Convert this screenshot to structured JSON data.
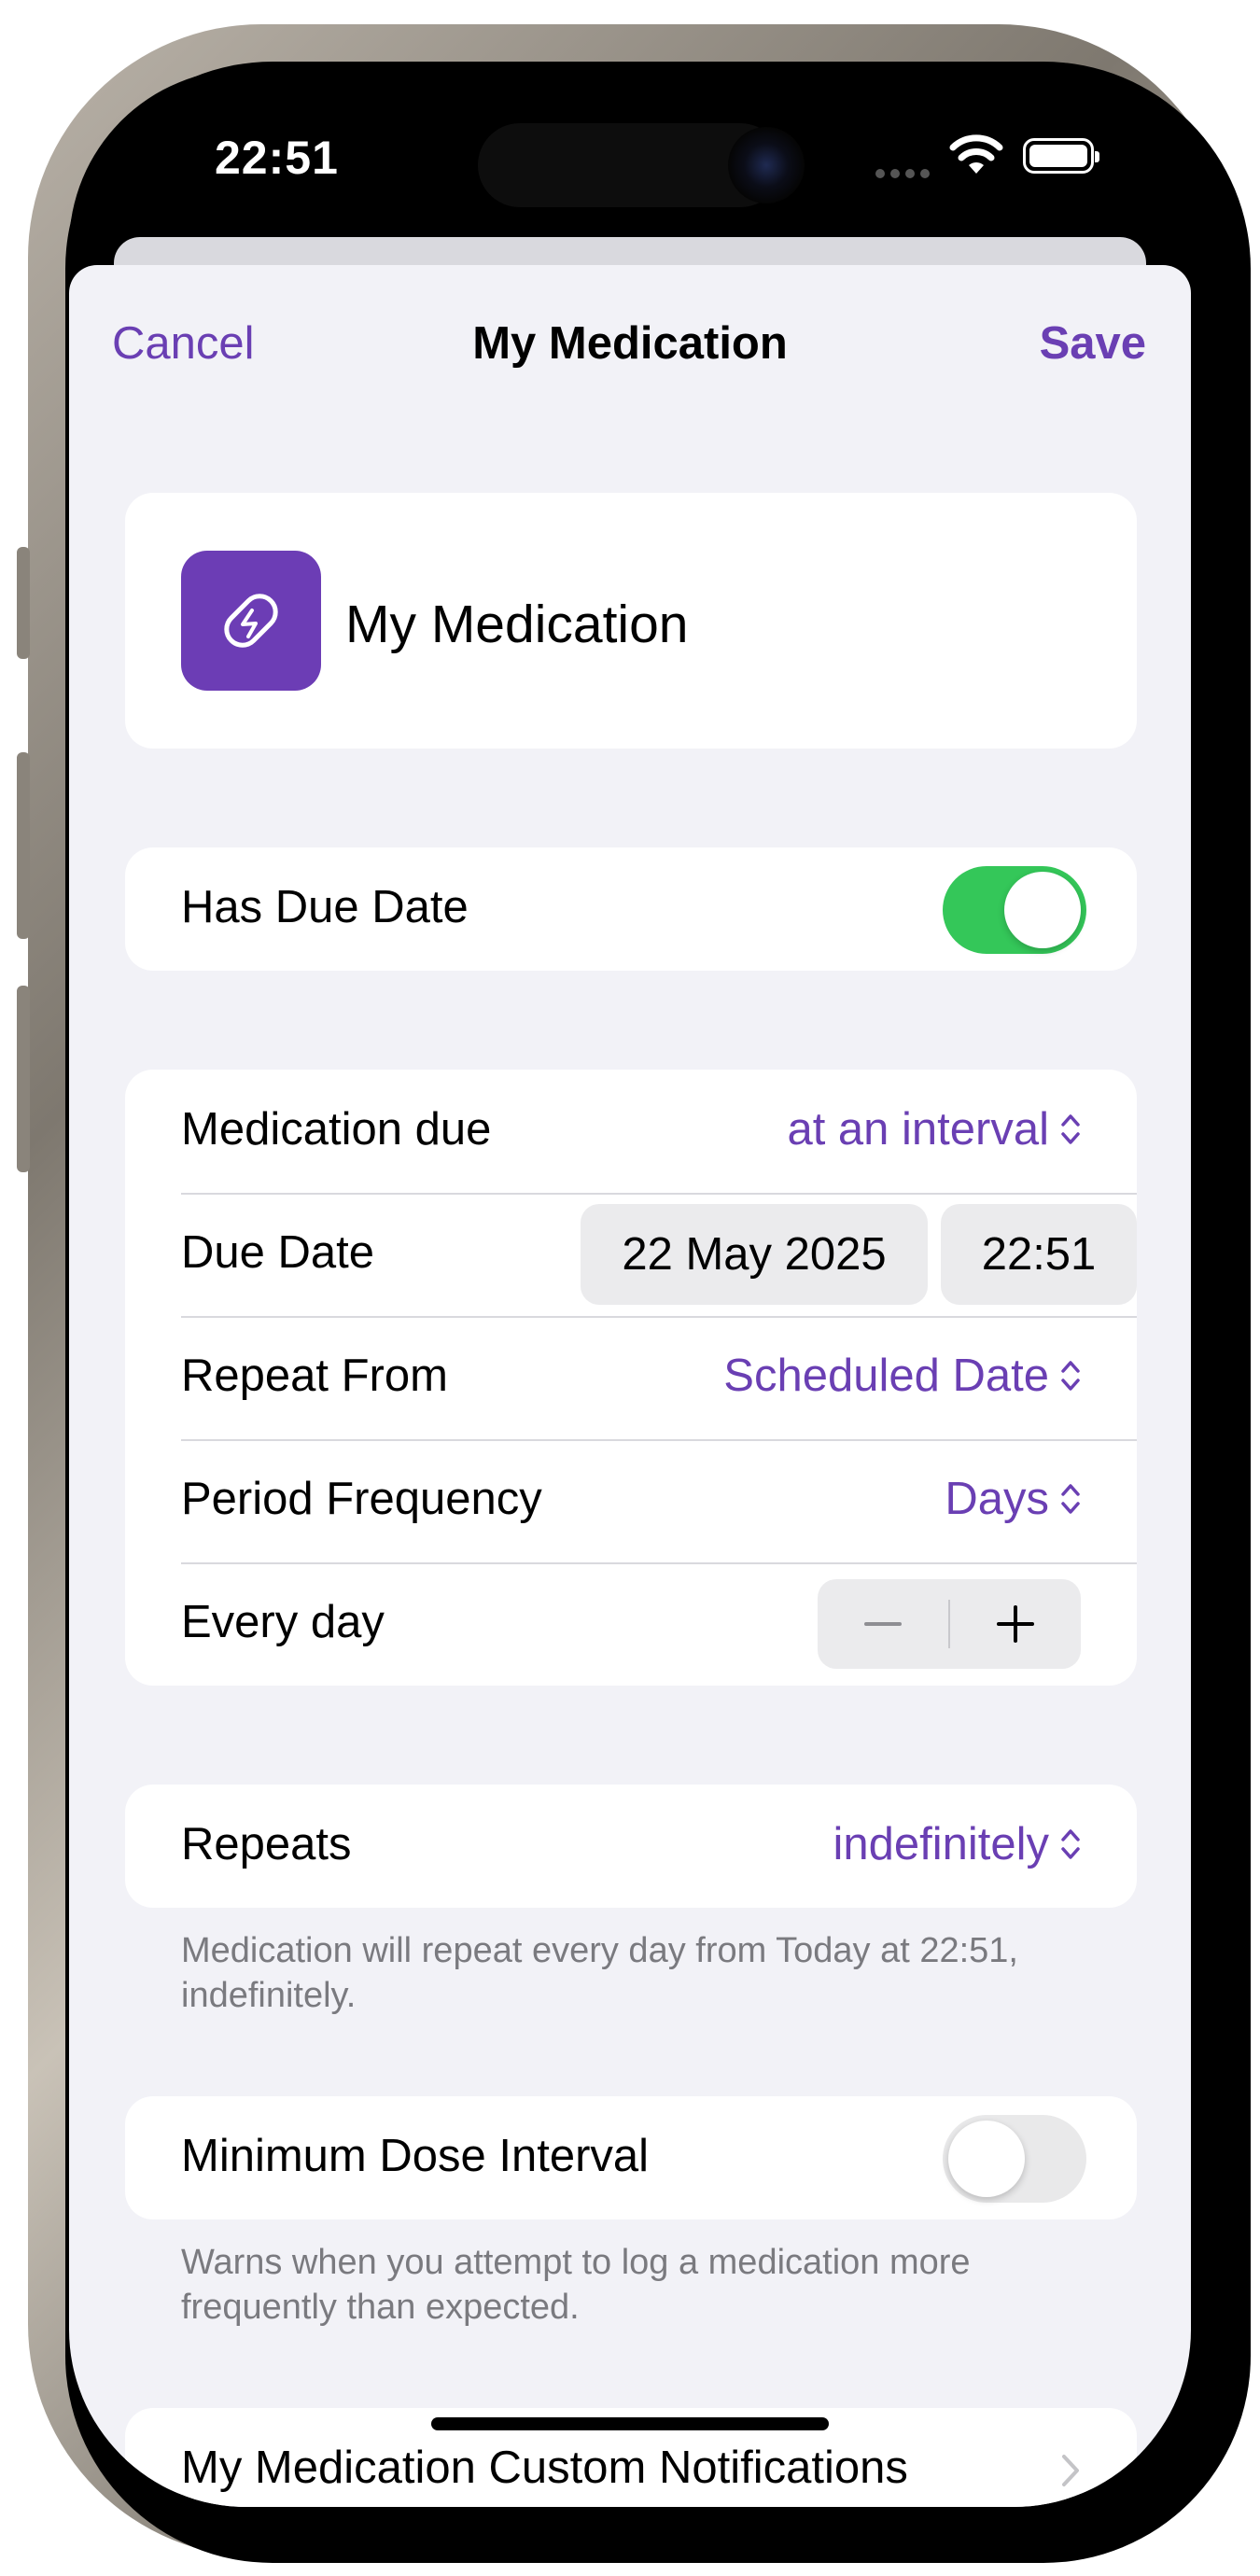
{
  "status_bar": {
    "time": "22:51"
  },
  "nav": {
    "cancel": "Cancel",
    "title": "My Medication",
    "save": "Save"
  },
  "medication": {
    "name": "My Medication",
    "icon": "pill-icon",
    "icon_color": "#6c3db5"
  },
  "due_date_toggle": {
    "label": "Has Due Date",
    "on": true
  },
  "schedule": {
    "medication_due_label": "Medication due",
    "medication_due_value": "at an interval",
    "due_date_label": "Due Date",
    "due_date_date": "22 May 2025",
    "due_date_time": "22:51",
    "repeat_from_label": "Repeat From",
    "repeat_from_value": "Scheduled Date",
    "period_frequency_label": "Period Frequency",
    "period_frequency_value": "Days",
    "every_label": "Every day"
  },
  "repeats": {
    "label": "Repeats",
    "value": "indefinitely",
    "footnote": "Medication will repeat every day from Today at 22:51, indefinitely."
  },
  "min_dose": {
    "label": "Minimum Dose Interval",
    "on": false,
    "footnote": "Warns when you attempt to log a medication more frequently than expected."
  },
  "custom_notifications": {
    "label": "My Medication Custom Notifications"
  },
  "colors": {
    "accent": "#6a3fb3",
    "toggle_on": "#34c759",
    "background": "#f2f2f7"
  }
}
